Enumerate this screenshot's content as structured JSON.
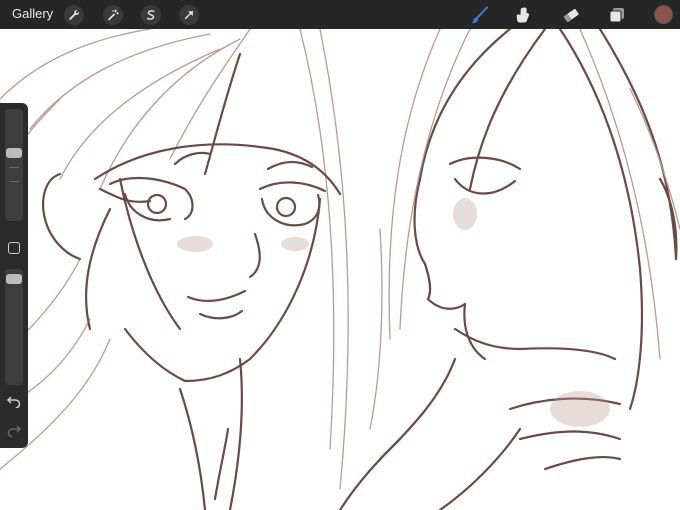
{
  "toolbar": {
    "gallery_label": "Gallery",
    "left_tools": [
      "wrench-icon",
      "magic-wand-icon",
      "selection-icon",
      "transform-arrow-icon"
    ],
    "right_tools": [
      "brush-icon",
      "smudge-icon",
      "eraser-icon",
      "layers-icon"
    ],
    "active_tool": "brush-icon",
    "active_color": "#8a5448",
    "accent": "#3a7bd5"
  },
  "sidebar": {
    "brush_size_level": 0.62,
    "opacity_level": 0.95
  },
  "canvas": {
    "stroke_color": "#6b4a44",
    "light_stroke_color": "#b89a94"
  }
}
